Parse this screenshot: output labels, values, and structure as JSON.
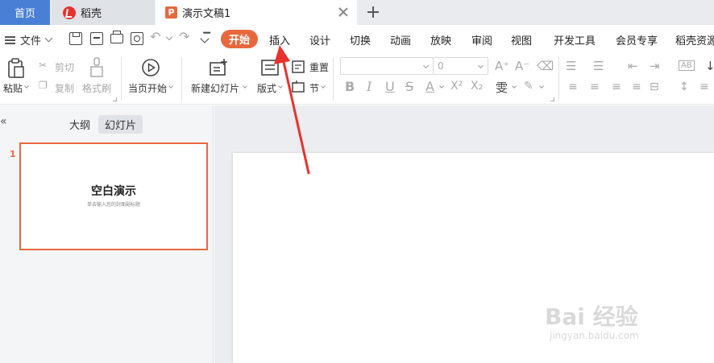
{
  "tabs": {
    "home": "首页",
    "daoke": "稻壳",
    "doc": "演示文稿1",
    "doc_icon": "P"
  },
  "menu": {
    "file": "文件",
    "tabs": [
      "开始",
      "插入",
      "设计",
      "切换",
      "动画",
      "放映",
      "审阅",
      "视图",
      "开发工具",
      "会员专享",
      "稻壳资源"
    ],
    "active_index": 0,
    "accent_color": "#e8683d"
  },
  "ribbon": {
    "paste": "粘贴",
    "cut": "剪切",
    "copy": "复制",
    "format_painter": "格式刷",
    "from_current": "当页开始",
    "new_slide": "新建幻灯片",
    "layout": "版式",
    "reset": "重置",
    "section": "节",
    "font_size_value": "0"
  },
  "left_pane": {
    "outline_tab": "大纲",
    "slides_tab": "幻灯片",
    "slide_number": "1",
    "thumb_title": "空白演示",
    "thumb_subtitle": "单击输入您的封面副标题"
  },
  "watermark": {
    "main": "Bai 经验",
    "sub": "jingyan.baidu.com"
  }
}
